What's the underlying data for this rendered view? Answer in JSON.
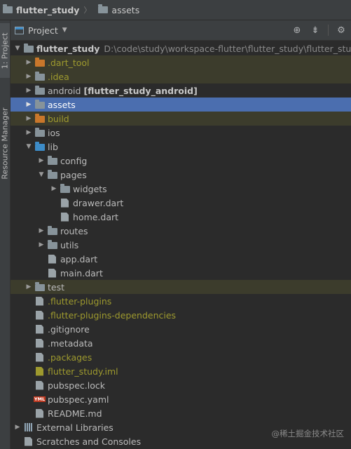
{
  "nav": {
    "project": "flutter_study",
    "folder": "assets"
  },
  "sidebar": {
    "tab_project": "1: Project",
    "tab_resource": "Resource Manager"
  },
  "toolbar": {
    "view_label": "Project"
  },
  "tree": {
    "root_name": "flutter_study",
    "root_path": "D:\\code\\study\\workspace-flutter\\flutter_study\\flutter_study",
    "dart_tool": ".dart_tool",
    "idea": ".idea",
    "android": "android",
    "android_module": "[flutter_study_android]",
    "assets": "assets",
    "build": "build",
    "ios": "ios",
    "lib": "lib",
    "config": "config",
    "pages": "pages",
    "widgets": "widgets",
    "drawer_dart": "drawer.dart",
    "home_dart": "home.dart",
    "routes": "routes",
    "utils": "utils",
    "app_dart": "app.dart",
    "main_dart": "main.dart",
    "test": "test",
    "flutter_plugins": ".flutter-plugins",
    "flutter_plugins_deps": ".flutter-plugins-dependencies",
    "gitignore": ".gitignore",
    "metadata": ".metadata",
    "packages": ".packages",
    "iml": "flutter_study.iml",
    "pubspec_lock": "pubspec.lock",
    "pubspec_yaml": "pubspec.yaml",
    "readme": "README.md",
    "external_libraries": "External Libraries",
    "scratches": "Scratches and Consoles"
  },
  "watermark": "@稀土掘金技术社区",
  "colors": {
    "selection": "#4b6eaf",
    "excluded_bg": "#3c3c2c",
    "excluded_text": "#9e9a2e",
    "orange_folder": "#c9772b",
    "blue_folder": "#3d8cc8"
  }
}
